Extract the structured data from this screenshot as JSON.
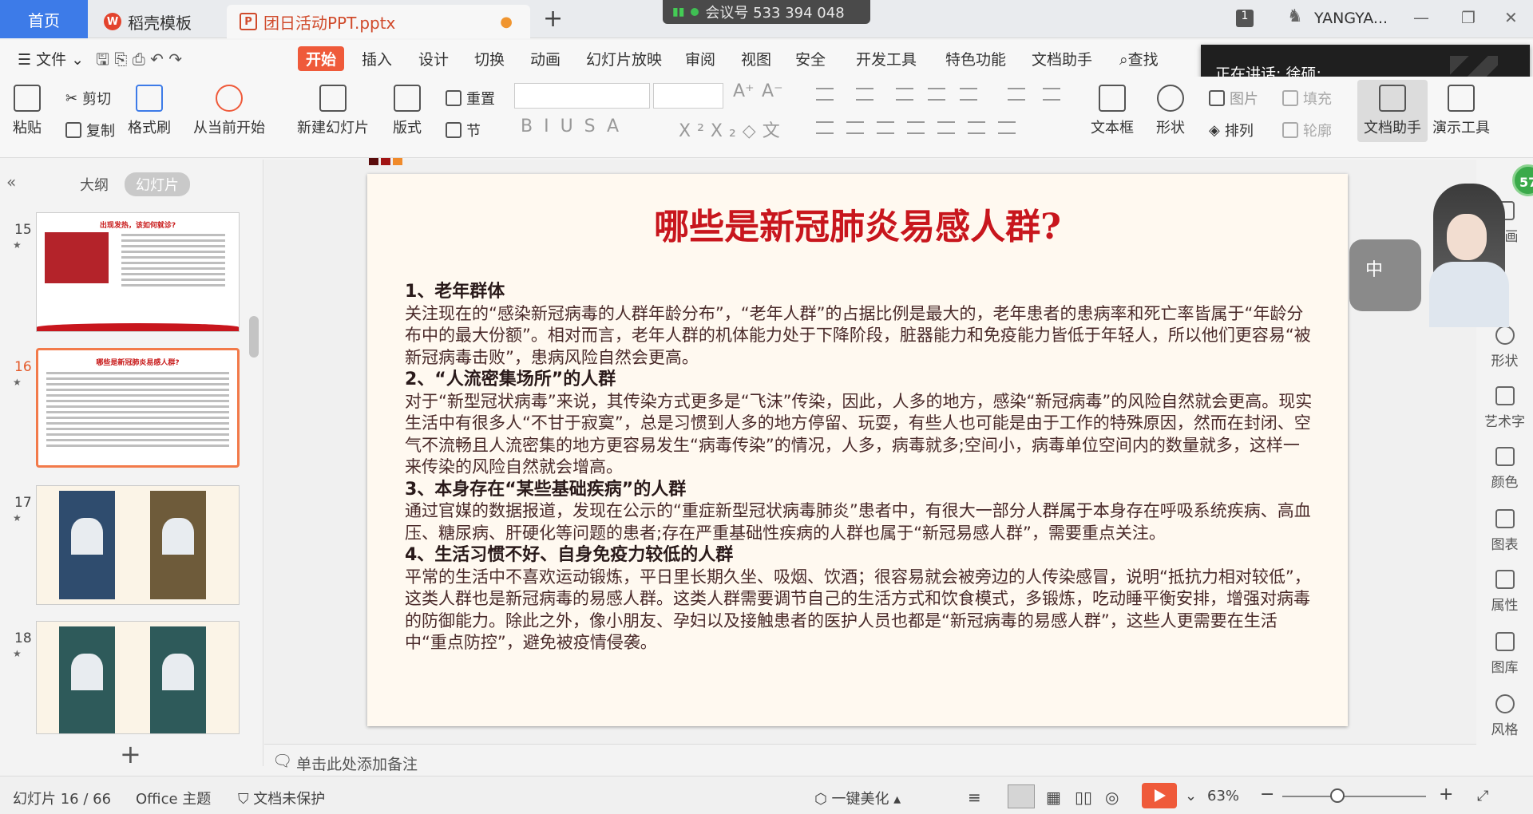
{
  "titlebar": {
    "tabs": [
      {
        "label": "首页"
      },
      {
        "label": "稻壳模板",
        "icon": "W"
      },
      {
        "label": "团日活动PPT.pptx",
        "icon": "P"
      }
    ],
    "meeting": "会议号 533 394 048",
    "account_badge": "1",
    "user": "YANGYA..."
  },
  "menu": [
    "文件",
    "开始",
    "插入",
    "设计",
    "切换",
    "动画",
    "幻灯片放映",
    "审阅",
    "视图",
    "安全",
    "开发工具",
    "特色功能",
    "文档助手",
    "查找"
  ],
  "speaker": "正在讲话: 徐硕;",
  "toolbar": {
    "paste": "粘贴",
    "cut": "剪切",
    "copy": "复制",
    "format_painter": "格式刷",
    "from_start": "从当前开始",
    "new_slide": "新建幻灯片",
    "layout": "版式",
    "reset": "重置",
    "section": "节",
    "textbox": "文本框",
    "shape": "形状",
    "arrange": "排列",
    "picture": "图片",
    "fill": "填充",
    "outline": "轮廓",
    "doc_assistant": "文档助手",
    "presenter_tools": "演示工具"
  },
  "panel": {
    "outline": "大纲",
    "slides": "幻灯片",
    "thumbs": [
      {
        "num": "15",
        "title": "出现发热，该如何就诊?"
      },
      {
        "num": "16",
        "title": "哪些是新冠肺炎易感人群?"
      },
      {
        "num": "17",
        "title": ""
      },
      {
        "num": "18",
        "title": ""
      }
    ]
  },
  "slide": {
    "title": "哪些是新冠肺炎易感人群?",
    "sections": [
      {
        "heading": "1、老年群体",
        "text": "关注现在的“感染新冠病毒的人群年龄分布”，“老年人群”的占据比例是最大的，老年患者的患病率和死亡率皆属于“年龄分布中的最大份额”。相对而言，老年人群的机体能力处于下降阶段，脏器能力和免疫能力皆低于年轻人，所以他们更容易“被新冠病毒击败”，患病风险自然会更高。"
      },
      {
        "heading": "2、“人流密集场所”的人群",
        "text": "对于“新型冠状病毒”来说，其传染方式更多是“飞沫”传染，因此，人多的地方，感染“新冠病毒”的风险自然就会更高。现实生活中有很多人“不甘于寂寞”，总是习惯到人多的地方停留、玩耍，有些人也可能是由于工作的特殊原因，然而在封闭、空气不流畅且人流密集的地方更容易发生“病毒传染”的情况，人多，病毒就多;空间小，病毒单位空间内的数量就多，这样一来传染的风险自然就会增高。"
      },
      {
        "heading": "3、本身存在“某些基础疾病”的人群",
        "text": "通过官媒的数据报道，发现在公示的“重症新型冠状病毒肺炎”患者中，有很大一部分人群属于本身存在呼吸系统疾病、高血压、糖尿病、肝硬化等问题的患者;存在严重基础性疾病的人群也属于“新冠易感人群”，需要重点关注。"
      },
      {
        "heading": "4、生活习惯不好、自身免疫力较低的人群",
        "text": "平常的生活中不喜欢运动锻炼，平日里长期久坐、吸烟、饮酒；很容易就会被旁边的人传染感冒，说明“抵抗力相对较低”，这类人群也是新冠病毒的易感人群。这类人群需要调节自己的生活方式和饮食模式，多锻炼，吃动睡平衡安排，增强对病毒的防御能力。除此之外，像小朋友、孕妇以及接触患者的医护人员也都是“新冠病毒的易感人群”，这些人更需要在生活中“重点防控”，避免被疫情侵袭。"
      }
    ]
  },
  "notes_placeholder": "单击此处添加备注",
  "rightbar": [
    "动画",
    "形状",
    "艺术字",
    "颜色",
    "图表",
    "属性",
    "图库",
    "风格"
  ],
  "avatar_char": "中",
  "green_badge": "57",
  "status": {
    "slide_pos": "幻灯片 16 / 66",
    "theme": "Office 主题",
    "protect": "文档未保护",
    "beautify": "一键美化",
    "zoom": "63%"
  },
  "colors": {
    "accent": "#ef5a3a",
    "title_red": "#c8161d",
    "selected_border": "#f27a4a"
  }
}
